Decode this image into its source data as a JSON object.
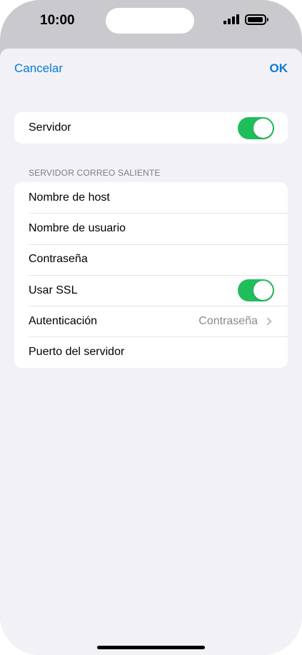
{
  "status_bar": {
    "time": "10:00"
  },
  "nav": {
    "cancel_label": "Cancelar",
    "ok_label": "OK"
  },
  "server_group": {
    "server_label": "Servidor",
    "server_enabled": true
  },
  "outgoing": {
    "section_title": "SERVIDOR CORREO SALIENTE",
    "host_label": "Nombre de host",
    "username_label": "Nombre de usuario",
    "password_label": "Contraseña",
    "ssl_label": "Usar SSL",
    "ssl_enabled": true,
    "auth_label": "Autenticación",
    "auth_value": "Contraseña",
    "port_label": "Puerto del servidor"
  },
  "colors": {
    "accent": "#0a7ad6",
    "toggle_on": "#1fbe5a",
    "background": "#f1f1f6"
  },
  "icons": {
    "signal": "cellular-signal-icon",
    "battery": "battery-icon",
    "chevron": "chevron-right-icon"
  }
}
